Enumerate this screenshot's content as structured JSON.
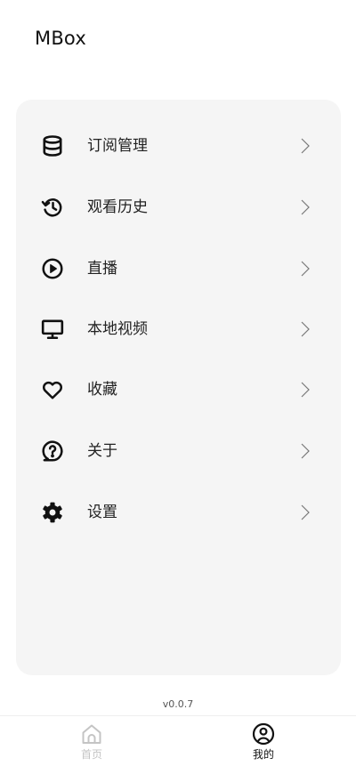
{
  "app": {
    "title": "MBox",
    "version": "v0.0.7"
  },
  "menu": {
    "items": [
      {
        "label": "订阅管理",
        "icon": "database-icon"
      },
      {
        "label": "观看历史",
        "icon": "history-icon"
      },
      {
        "label": "直播",
        "icon": "play-circle-icon"
      },
      {
        "label": "本地视频",
        "icon": "monitor-icon"
      },
      {
        "label": "收藏",
        "icon": "heart-icon"
      },
      {
        "label": "关于",
        "icon": "help-circle-icon"
      },
      {
        "label": "设置",
        "icon": "gear-icon"
      }
    ],
    "chevron_icon": "chevron-right-icon"
  },
  "bottom_nav": {
    "items": [
      {
        "label": "首页",
        "icon": "home-icon",
        "active": false
      },
      {
        "label": "我的",
        "icon": "user-circle-icon",
        "active": true
      }
    ],
    "active_color": "#111111",
    "inactive_color": "#c4c4c4"
  },
  "colors": {
    "card_background": "#f5f5f5",
    "text": "#222222"
  }
}
